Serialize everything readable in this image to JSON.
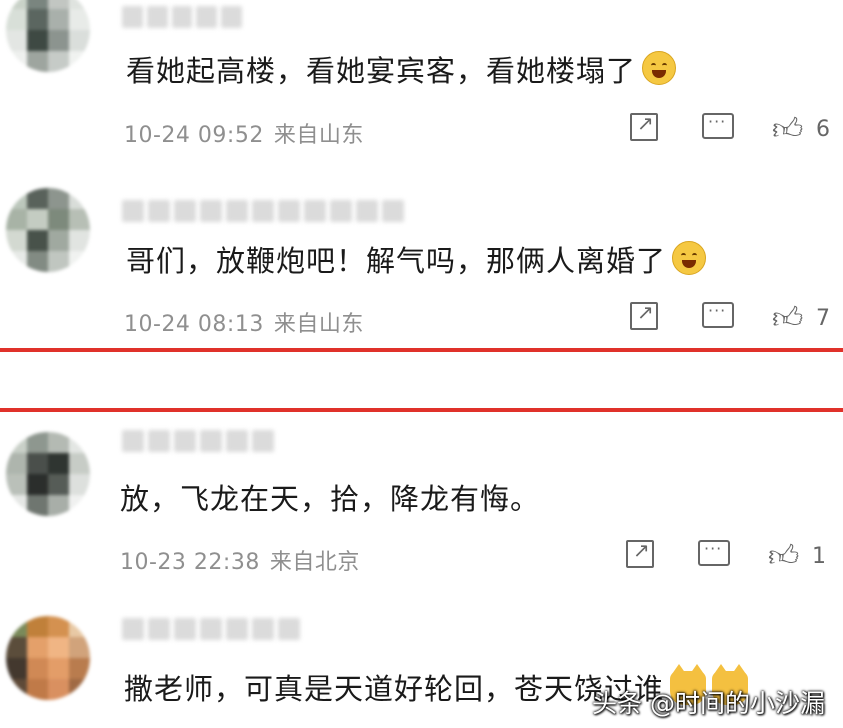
{
  "comments": [
    {
      "text": "看她起高楼，看她宴宾客，看她楼塌了",
      "date": "10-24 09:52",
      "location": "来自山东",
      "likes": "6",
      "emoji": "laughing-tears"
    },
    {
      "text": "哥们，放鞭炮吧！解气吗，那俩人离婚了",
      "date": "10-24 08:13",
      "location": "来自山东",
      "likes": "7",
      "emoji": "laughing-tears"
    },
    {
      "text": "放，飞龙在天，拾，降龙有悔。",
      "date": "10-23 22:38",
      "location": "来自北京",
      "likes": "1"
    },
    {
      "text": "撒老师，可真是天道好轮回，苍天饶过谁",
      "emoji": "cat-face"
    }
  ],
  "watermark": "头条 @时间的小沙漏",
  "colors": {
    "divider": "#e0312a",
    "meta": "#8f8f8f",
    "icon": "#666666"
  },
  "icons": [
    "share-icon",
    "reply-icon",
    "like-icon",
    "laughing-emoji",
    "cat-emoji"
  ]
}
